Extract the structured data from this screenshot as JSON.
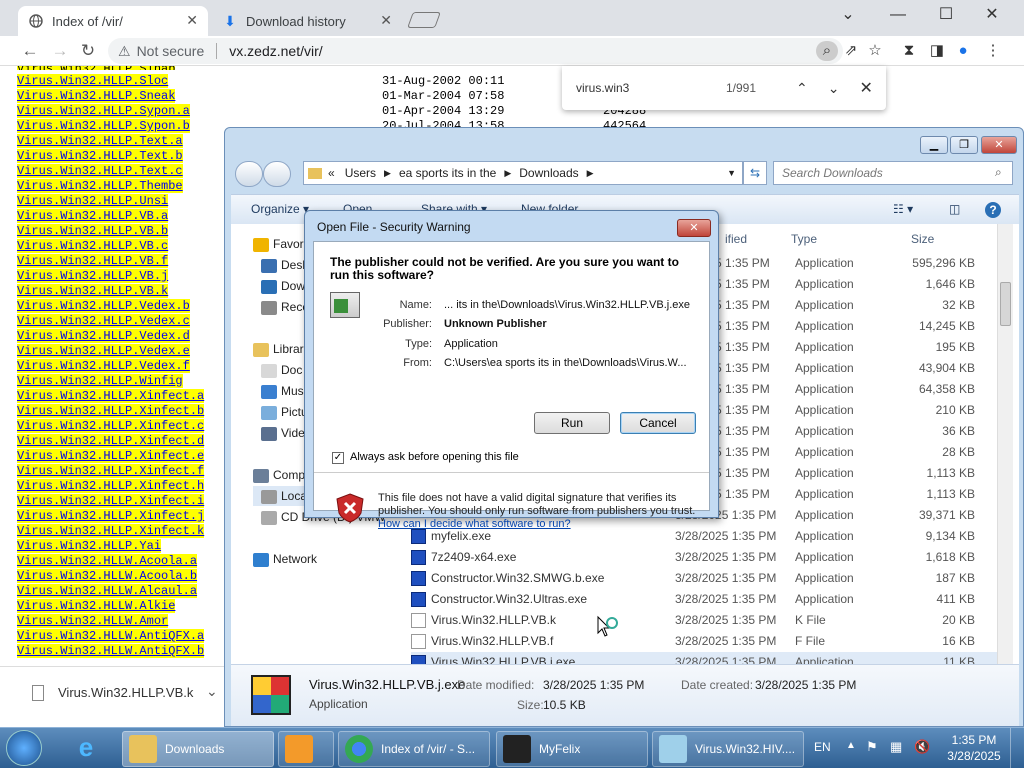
{
  "browser": {
    "tabs": [
      {
        "title": "Index of /vir/",
        "active": true
      },
      {
        "title": "Download history",
        "active": false
      }
    ],
    "security_label": "Not secure",
    "url": "vx.zedz.net/vir/",
    "find": {
      "query": "virus.win3",
      "count": "1/991"
    }
  },
  "listing": {
    "rows": [
      {
        "pre": "Virus.Win3",
        "post": "2.HLLP.Sloc",
        "date": "31-Aug-2002 00:11",
        "size": ""
      },
      {
        "pre": "Virus.Win3",
        "post": "2.HLLP.Sneak",
        "date": "01-Mar-2004 07:58",
        "size": ""
      },
      {
        "pre": "Virus.Win3",
        "post": "2.HLLP.Sypon.a",
        "date": "01-Apr-2004 13:29",
        "size": "204288"
      },
      {
        "pre": "Virus.Win3",
        "post": "2.HLLP.Sypon.b",
        "date": "20-Jul-2004 13:58",
        "size": "442564"
      },
      {
        "pre": "Virus.Win3",
        "post": "2.HLLP.Text.a",
        "date": "",
        "size": ""
      },
      {
        "pre": "Virus.Win3",
        "post": "2.HLLP.Text.b",
        "date": "",
        "size": ""
      },
      {
        "pre": "Virus.Win3",
        "post": "2.HLLP.Text.c",
        "date": "",
        "size": ""
      },
      {
        "pre": "Virus.Win3",
        "post": "2.HLLP.Thembe",
        "date": "",
        "size": ""
      },
      {
        "pre": "Virus.Win3",
        "post": "2.HLLP.Unsi",
        "date": "",
        "size": ""
      },
      {
        "pre": "Virus.Win3",
        "post": "2.HLLP.VB.a",
        "date": "",
        "size": ""
      },
      {
        "pre": "Virus.Win3",
        "post": "2.HLLP.VB.b",
        "date": "",
        "size": ""
      },
      {
        "pre": "Virus.Win3",
        "post": "2.HLLP.VB.c",
        "date": "",
        "size": ""
      },
      {
        "pre": "Virus.Win3",
        "post": "2.HLLP.VB.f",
        "date": "",
        "size": ""
      },
      {
        "pre": "Virus.Win3",
        "post": "2.HLLP.VB.j",
        "date": "",
        "size": ""
      },
      {
        "pre": "Virus.Win3",
        "post": "2.HLLP.VB.k",
        "date": "",
        "size": ""
      },
      {
        "pre": "Virus.Win3",
        "post": "2.HLLP.Vedex.b",
        "date": "",
        "size": ""
      },
      {
        "pre": "Virus.Win3",
        "post": "2.HLLP.Vedex.c",
        "date": "",
        "size": ""
      },
      {
        "pre": "Virus.Win3",
        "post": "2.HLLP.Vedex.d",
        "date": "",
        "size": ""
      },
      {
        "pre": "Virus.Win3",
        "post": "2.HLLP.Vedex.e",
        "date": "",
        "size": ""
      },
      {
        "pre": "Virus.Win3",
        "post": "2.HLLP.Vedex.f",
        "date": "",
        "size": ""
      },
      {
        "pre": "Virus.Win3",
        "post": "2.HLLP.Winfig",
        "date": "",
        "size": ""
      },
      {
        "pre": "Virus.Win3",
        "post": "2.HLLP.Xinfect.a",
        "date": "",
        "size": ""
      },
      {
        "pre": "Virus.Win3",
        "post": "2.HLLP.Xinfect.b",
        "date": "",
        "size": ""
      },
      {
        "pre": "Virus.Win3",
        "post": "2.HLLP.Xinfect.c",
        "date": "",
        "size": ""
      },
      {
        "pre": "Virus.Win3",
        "post": "2.HLLP.Xinfect.d",
        "date": "",
        "size": ""
      },
      {
        "pre": "Virus.Win3",
        "post": "2.HLLP.Xinfect.e",
        "date": "",
        "size": ""
      },
      {
        "pre": "Virus.Win3",
        "post": "2.HLLP.Xinfect.f",
        "date": "",
        "size": ""
      },
      {
        "pre": "Virus.Win3",
        "post": "2.HLLP.Xinfect.h",
        "date": "",
        "size": ""
      },
      {
        "pre": "Virus.Win3",
        "post": "2.HLLP.Xinfect.i",
        "date": "",
        "size": ""
      },
      {
        "pre": "Virus.Win3",
        "post": "2.HLLP.Xinfect.j",
        "date": "",
        "size": ""
      },
      {
        "pre": "Virus.Win3",
        "post": "2.HLLP.Xinfect.k",
        "date": "",
        "size": ""
      },
      {
        "pre": "Virus.Win3",
        "post": "2.HLLP.Yai",
        "date": "",
        "size": ""
      },
      {
        "pre": "Virus.Win3",
        "post": "2.HLLW.Acoola.a",
        "date": "",
        "size": ""
      },
      {
        "pre": "Virus.Win3",
        "post": "2.HLLW.Acoola.b",
        "date": "",
        "size": ""
      },
      {
        "pre": "Virus.Win3",
        "post": "2.HLLW.Alcaul.a",
        "date": "",
        "size": ""
      },
      {
        "pre": "Virus.Win3",
        "post": "2.HLLW.Alkie",
        "date": "",
        "size": ""
      },
      {
        "pre": "Virus.Win3",
        "post": "2.HLLW.Amor",
        "date": "",
        "size": ""
      },
      {
        "pre": "Virus.Win3",
        "post": "2.HLLW.AntiQFX.a",
        "date": "",
        "size": ""
      },
      {
        "pre": "Virus.Win3",
        "post": "2.HLLW.AntiQFX.b",
        "date": "",
        "size": ""
      }
    ]
  },
  "download_shelf": {
    "file": "Virus.Win32.HLLP.VB.k"
  },
  "explorer": {
    "breadcrumb": [
      "Users",
      "ea sports its in the",
      "Downloads"
    ],
    "search_placeholder": "Search Downloads",
    "commands": {
      "organize": "Organize",
      "open": "Open",
      "share": "Share with",
      "new_folder": "New folder"
    },
    "columns": {
      "modified": "ified",
      "type": "Type",
      "size": "Size"
    },
    "nav": [
      {
        "label": "Favori",
        "group": true
      },
      {
        "label": "Desk"
      },
      {
        "label": "Dow"
      },
      {
        "label": "Rece"
      },
      {
        "label": "Librar",
        "group": true
      },
      {
        "label": "Doc"
      },
      {
        "label": "Mus"
      },
      {
        "label": "Pictu"
      },
      {
        "label": "Vide"
      },
      {
        "label": "Comp",
        "group": true
      },
      {
        "label": "Loca"
      },
      {
        "label": "CD Drive (D:) VMW"
      },
      {
        "label": "Network",
        "group": true
      }
    ],
    "files": [
      {
        "name": "",
        "date": "/28/2025 1:35 PM",
        "type": "Application",
        "size": "595,296 KB"
      },
      {
        "name": "",
        "date": "/28/2025 1:35 PM",
        "type": "Application",
        "size": "1,646 KB"
      },
      {
        "name": "",
        "date": "/28/2025 1:35 PM",
        "type": "Application",
        "size": "32 KB"
      },
      {
        "name": "",
        "date": "/28/2025 1:35 PM",
        "type": "Application",
        "size": "14,245 KB"
      },
      {
        "name": "",
        "date": "/28/2025 1:35 PM",
        "type": "Application",
        "size": "195 KB"
      },
      {
        "name": "",
        "date": "/28/2025 1:35 PM",
        "type": "Application",
        "size": "43,904 KB"
      },
      {
        "name": "",
        "date": "/28/2025 1:35 PM",
        "type": "Application",
        "size": "64,358 KB"
      },
      {
        "name": "",
        "date": "/28/2025 1:35 PM",
        "type": "Application",
        "size": "210 KB"
      },
      {
        "name": "",
        "date": "/28/2025 1:35 PM",
        "type": "Application",
        "size": "36 KB"
      },
      {
        "name": "",
        "date": "/28/2025 1:35 PM",
        "type": "Application",
        "size": "28 KB"
      },
      {
        "name": "",
        "date": "/28/2025 1:35 PM",
        "type": "Application",
        "size": "1,113 KB"
      },
      {
        "name": "",
        "date": "/28/2025 1:35 PM",
        "type": "Application",
        "size": "1,113 KB"
      },
      {
        "name": "",
        "date": "3/28/2025 1:35 PM",
        "type": "Application",
        "size": "39,371 KB"
      },
      {
        "name": "myfelix.exe",
        "date": "3/28/2025 1:35 PM",
        "type": "Application",
        "size": "9,134 KB"
      },
      {
        "name": "7z2409-x64.exe",
        "date": "3/28/2025 1:35 PM",
        "type": "Application",
        "size": "1,618 KB"
      },
      {
        "name": "Constructor.Win32.SMWG.b.exe",
        "date": "3/28/2025 1:35 PM",
        "type": "Application",
        "size": "187 KB"
      },
      {
        "name": "Constructor.Win32.Ultras.exe",
        "date": "3/28/2025 1:35 PM",
        "type": "Application",
        "size": "411 KB"
      },
      {
        "name": "Virus.Win32.HLLP.VB.k",
        "date": "3/28/2025 1:35 PM",
        "type": "K File",
        "size": "20 KB"
      },
      {
        "name": "Virus.Win32.HLLP.VB.f",
        "date": "3/28/2025 1:35 PM",
        "type": "F File",
        "size": "16 KB"
      },
      {
        "name": "Virus.Win32.HLLP.VB.j.exe",
        "date": "3/28/2025 1:35 PM",
        "type": "Application",
        "size": "11 KB"
      }
    ],
    "details": {
      "name": "Virus.Win32.HLLP.VB.j.exe",
      "type": "Application",
      "modified_label": "Date modified:",
      "modified": "3/28/2025 1:35 PM",
      "created_label": "Date created:",
      "created": "3/28/2025 1:35 PM",
      "size_label": "Size:",
      "size": "10.5 KB"
    }
  },
  "dialog": {
    "title": "Open File - Security Warning",
    "heading": "The publisher could not be verified.  Are you sure you want to run this software?",
    "name_label": "Name:",
    "name": "... its in the\\Downloads\\Virus.Win32.HLLP.VB.j.exe",
    "publisher_label": "Publisher:",
    "publisher": "Unknown Publisher",
    "type_label": "Type:",
    "type": "Application",
    "from_label": "From:",
    "from": "C:\\Users\\ea sports its in the\\Downloads\\Virus.W...",
    "run": "Run",
    "cancel": "Cancel",
    "always_ask": "Always ask before opening this file",
    "warning": "This file does not have a valid digital signature that verifies its publisher.  You should only run software from publishers you trust.",
    "help_link": "How can I decide what software to run?"
  },
  "taskbar": {
    "items": [
      {
        "label": "Downloads"
      },
      {
        "label": ""
      },
      {
        "label": "Index of /vir/ - S..."
      },
      {
        "label": "MyFelix"
      },
      {
        "label": "Virus.Win32.HIV...."
      }
    ],
    "lang": "EN",
    "time": "1:35 PM",
    "date": "3/28/2025"
  }
}
